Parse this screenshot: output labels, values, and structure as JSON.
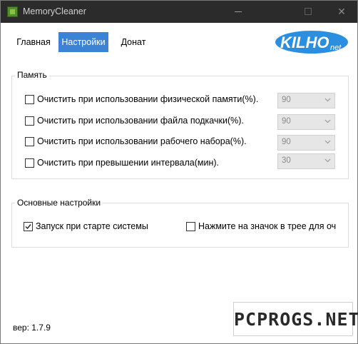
{
  "window": {
    "title": "MemoryCleaner",
    "controls": {
      "minimize": "—",
      "maximize": "☐",
      "close": "✕"
    }
  },
  "tabs": [
    {
      "label": "Главная",
      "active": false
    },
    {
      "label": "Настройки",
      "active": true
    },
    {
      "label": "Донат",
      "active": false
    }
  ],
  "logo": {
    "text": "KILHO",
    "suffix": "net",
    "accent_color": "#2a8fe0"
  },
  "memory_group": {
    "title": "Память",
    "options": [
      {
        "label": "Очистить при использовании физической памяти(%).",
        "checked": false,
        "value": "90"
      },
      {
        "label": "Очистить при использовании файла подкачки(%).",
        "checked": false,
        "value": "90"
      },
      {
        "label": "Очистить при использовании рабочего набора(%).",
        "checked": false,
        "value": "90"
      },
      {
        "label": "Очистить при превышении интервала(мин).",
        "checked": false,
        "value": "30"
      }
    ]
  },
  "basic_group": {
    "title": "Основные настройки",
    "options": [
      {
        "label": "Запуск при старте системы",
        "checked": true
      },
      {
        "label": "Нажмите на значок в трее для очи",
        "checked": false
      }
    ]
  },
  "version": "вер: 1.7.9",
  "watermark": "PCPROGS.NET",
  "colors": {
    "titlebar": "#2b2b2b",
    "active_tab": "#3c83d6"
  }
}
